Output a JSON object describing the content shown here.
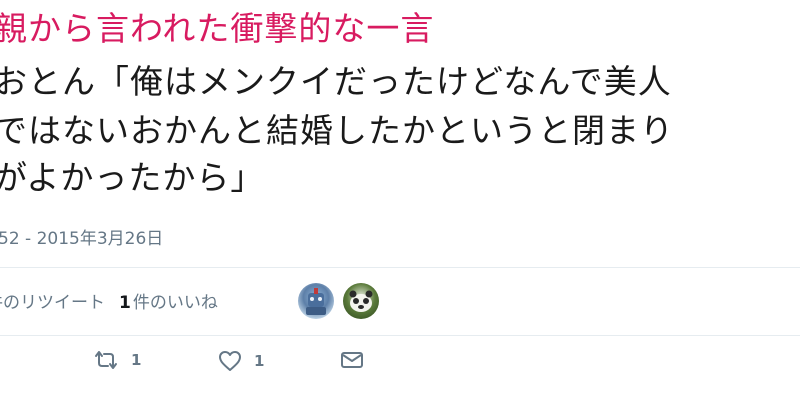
{
  "tweet": {
    "headline": "親から言われた衝撃的な一言",
    "body_lines": [
      "おとん「俺はメンクイだったけどなんで美人",
      "ではないおかんと結婚したかというと閉まり",
      "がよかったから」"
    ],
    "timestamp": "52 - 2015年3月26日",
    "stats": {
      "retweets_label": "件のリツイート",
      "likes_count": "1",
      "likes_label": "件のいいね"
    },
    "actions": {
      "retweet_count": "1",
      "like_count": "1"
    }
  },
  "icons": {
    "retweet": "retweet-icon",
    "like": "heart-icon",
    "message": "envelope-icon"
  },
  "colors": {
    "headline": "#d81b60",
    "meta_text": "#657786",
    "divider": "#e6ecf0"
  }
}
